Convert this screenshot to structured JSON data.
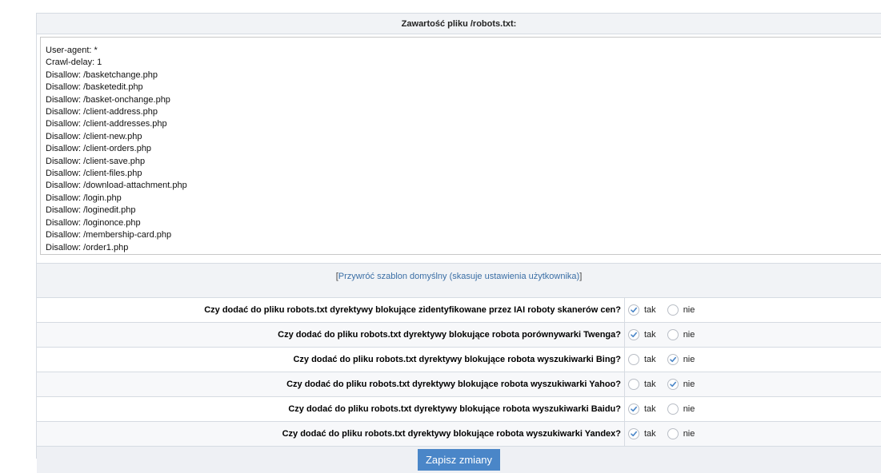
{
  "header": {
    "title": "Zawartość pliku /robots.txt:"
  },
  "editor": {
    "lines": [
      "User-agent: *",
      "Crawl-delay: 1",
      "Disallow: /basketchange.php",
      "Disallow: /basketedit.php",
      "Disallow: /basket-onchange.php",
      "Disallow: /client-address.php",
      "Disallow: /client-addresses.php",
      "Disallow: /client-new.php",
      "Disallow: /client-orders.php",
      "Disallow: /client-save.php",
      "Disallow: /client-files.php",
      "Disallow: /download-attachment.php",
      "Disallow: /login.php",
      "Disallow: /loginedit.php",
      "Disallow: /loginonce.php",
      "Disallow: /membership-card.php",
      "Disallow: /order1.php"
    ]
  },
  "restore": {
    "open_bracket": "[",
    "link_text": "Przywróć szablon domyślny (skasuje ustawienia użytkownika)",
    "close_bracket": "]"
  },
  "questions": [
    {
      "label": "Czy dodać do pliku robots.txt dyrektywy blokujące zidentyfikowane przez IAI roboty skanerów cen?",
      "yes": "tak",
      "no": "nie",
      "selected": "tak"
    },
    {
      "label": "Czy dodać do pliku robots.txt dyrektywy blokujące robota porównywarki Twenga?",
      "yes": "tak",
      "no": "nie",
      "selected": "tak"
    },
    {
      "label": "Czy dodać do pliku robots.txt dyrektywy blokujące robota wyszukiwarki Bing?",
      "yes": "tak",
      "no": "nie",
      "selected": "nie"
    },
    {
      "label": "Czy dodać do pliku robots.txt dyrektywy blokujące robota wyszukiwarki Yahoo?",
      "yes": "tak",
      "no": "nie",
      "selected": "nie"
    },
    {
      "label": "Czy dodać do pliku robots.txt dyrektywy blokujące robota wyszukiwarki Baidu?",
      "yes": "tak",
      "no": "nie",
      "selected": "tak"
    },
    {
      "label": "Czy dodać do pliku robots.txt dyrektywy blokujące robota wyszukiwarki Yandex?",
      "yes": "tak",
      "no": "nie",
      "selected": "tak"
    }
  ],
  "footer": {
    "save_label": "Zapisz zmiany"
  },
  "colors": {
    "accent": "#4a86c8",
    "link": "#3a6ea5",
    "check": "#4a86c8"
  }
}
